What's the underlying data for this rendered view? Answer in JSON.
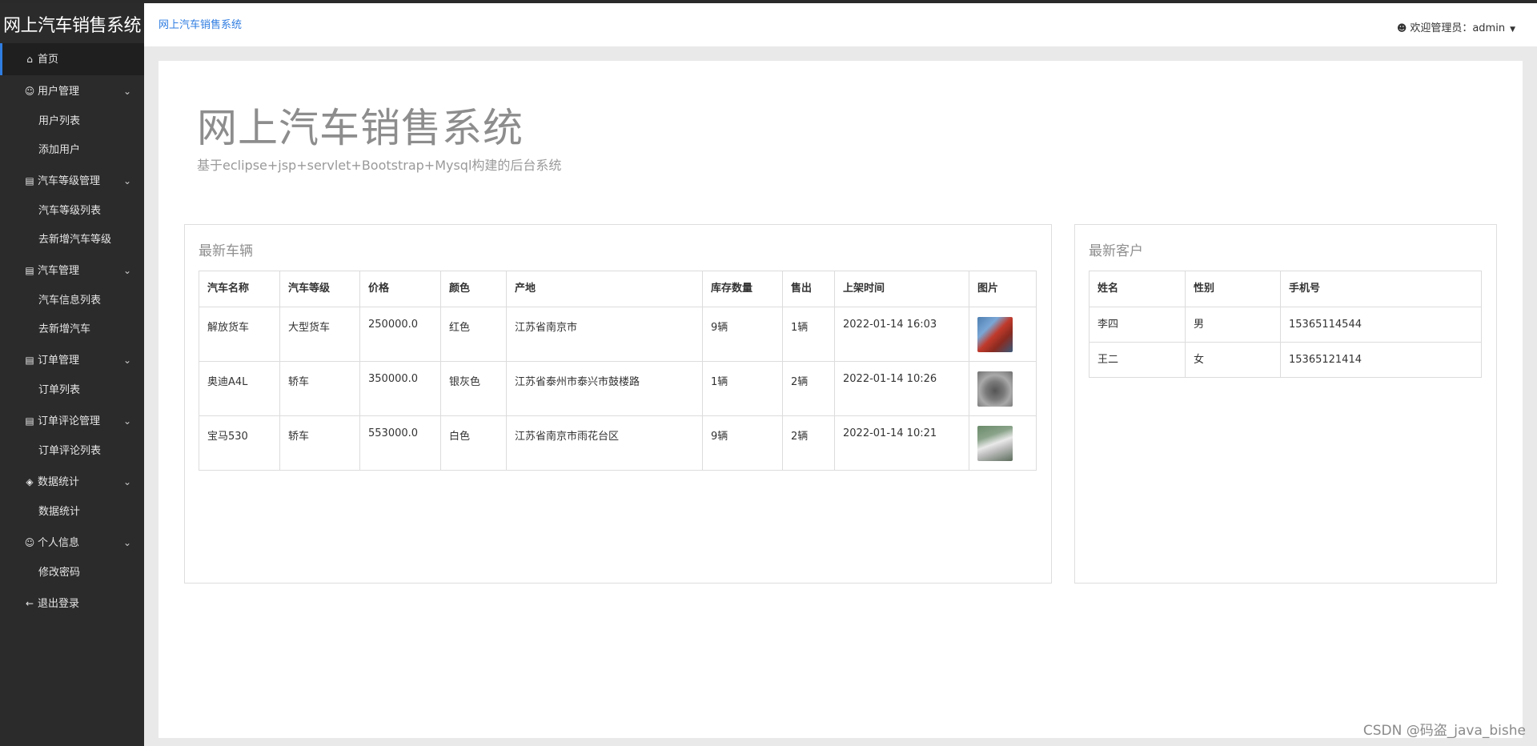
{
  "app": {
    "brand": "网上汽车销售系统"
  },
  "sidebar": {
    "home": {
      "icon": "home-icon",
      "label": "首页"
    },
    "groups": [
      {
        "icon": "user-circle-icon",
        "label": "用户管理",
        "items": [
          "用户列表",
          "添加用户"
        ]
      },
      {
        "icon": "document-icon",
        "label": "汽车等级管理",
        "items": [
          "汽车等级列表",
          "去新增汽车等级"
        ]
      },
      {
        "icon": "document-icon",
        "label": "汽车管理",
        "items": [
          "汽车信息列表",
          "去新增汽车"
        ]
      },
      {
        "icon": "document-icon",
        "label": "订单管理",
        "items": [
          "订单列表"
        ]
      },
      {
        "icon": "document-icon",
        "label": "订单评论管理",
        "items": [
          "订单评论列表"
        ]
      },
      {
        "icon": "layers-icon",
        "label": "数据统计",
        "items": [
          "数据统计"
        ]
      },
      {
        "icon": "user-circle-icon",
        "label": "个人信息",
        "items": [
          "修改密码"
        ]
      }
    ],
    "logout": {
      "icon": "arrow-left-icon",
      "label": "退出登录"
    }
  },
  "header": {
    "breadcrumb": "网上汽车销售系统",
    "welcome": "欢迎管理员：admin"
  },
  "hero": {
    "title": "网上汽车销售系统",
    "subtitle": "基于eclipse+jsp+servlet+Bootstrap+Mysql构建的后台系统"
  },
  "cars_panel": {
    "title": "最新车辆",
    "columns": [
      "汽车名称",
      "汽车等级",
      "价格",
      "颜色",
      "产地",
      "库存数量",
      "售出",
      "上架时间",
      "图片"
    ],
    "rows": [
      [
        "解放货车",
        "大型货车",
        "250000.0",
        "红色",
        "江苏省南京市",
        "9辆",
        "1辆",
        "2022-01-14 16:03"
      ],
      [
        "奥迪A4L",
        "轿车",
        "350000.0",
        "银灰色",
        "江苏省泰州市泰兴市鼓楼路",
        "1辆",
        "2辆",
        "2022-01-14 10:26"
      ],
      [
        "宝马530",
        "轿车",
        "553000.0",
        "白色",
        "江苏省南京市雨花台区",
        "9辆",
        "2辆",
        "2022-01-14 10:21"
      ]
    ]
  },
  "customers_panel": {
    "title": "最新客户",
    "columns": [
      "姓名",
      "性别",
      "手机号"
    ],
    "rows": [
      [
        "李四",
        "男",
        "15365114544"
      ],
      [
        "王二",
        "女",
        "15365121414"
      ]
    ]
  },
  "watermark": "CSDN @码盗_java_bishe",
  "colors": {
    "sidebar_bg": "#2b2b2b",
    "accent": "#2f7de1",
    "page_bg": "#e9e9e9"
  }
}
